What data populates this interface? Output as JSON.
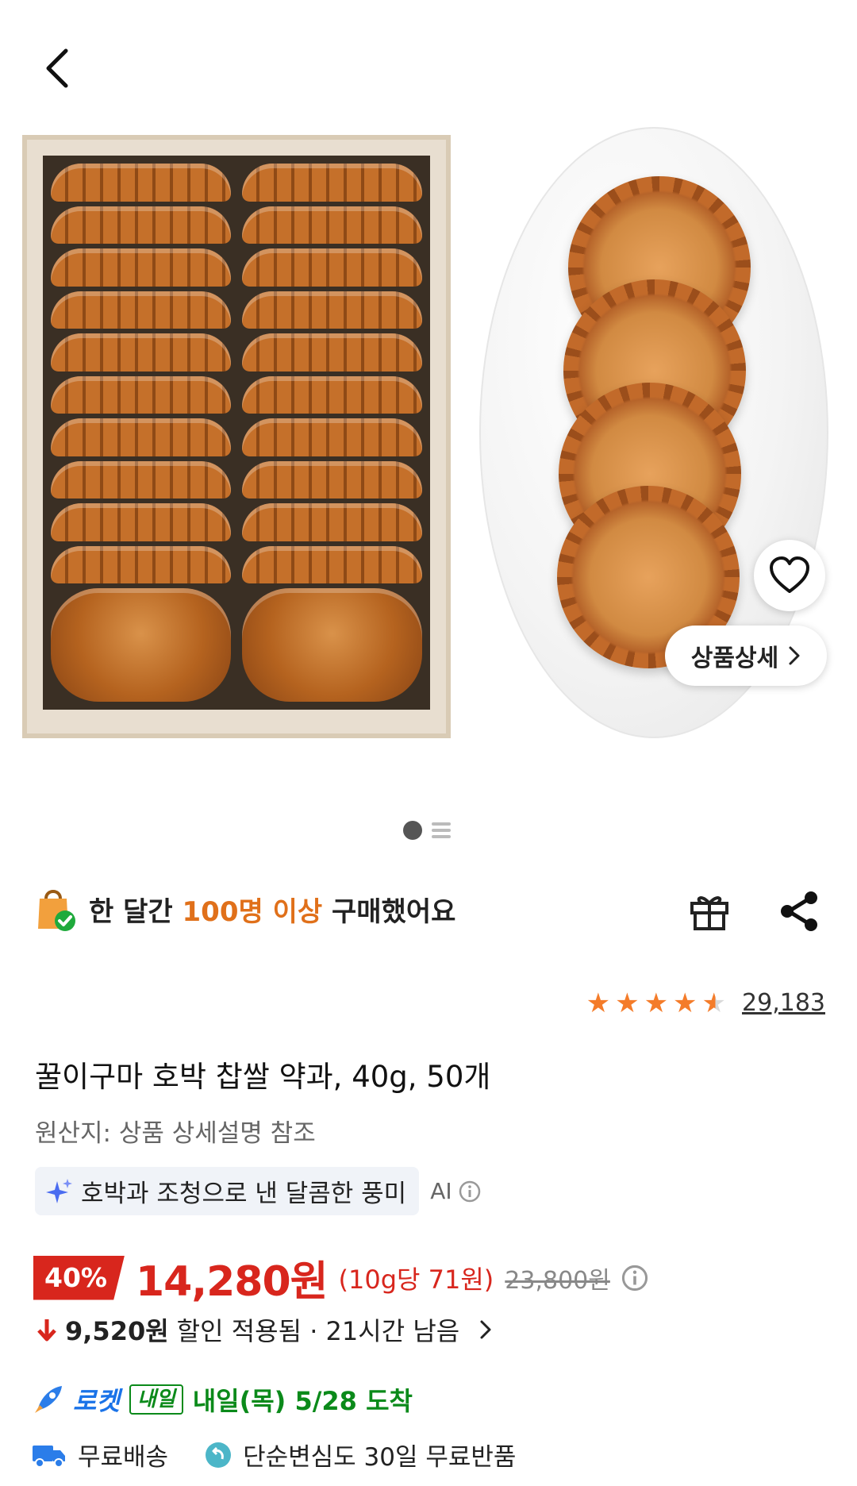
{
  "header": {
    "back_icon": "chevron-left-icon"
  },
  "gallery": {
    "detail_button_label": "상품상세",
    "page_indicator": {
      "current": 1,
      "total": 2
    }
  },
  "purchase_note": {
    "prefix": "한 달간 ",
    "highlight": "100명 이상",
    "suffix": " 구매했어요"
  },
  "rating": {
    "stars": 4.5,
    "review_count": "29,183"
  },
  "product": {
    "title": "꿀이구마 호박 찹쌀 약과, 40g, 50개",
    "origin": "원산지: 상품 상세설명 참조",
    "ai_summary": "호박과 조청으로 낸 달콤한 풍미",
    "ai_label": "AI"
  },
  "price": {
    "discount": "40%",
    "sale": "14,280원",
    "unit": "(10g당 71원)",
    "original": "23,800원"
  },
  "coupon": {
    "amount": "9,520원",
    "text": "할인 적용됨 · 21시간 남음"
  },
  "delivery": {
    "rocket_label": "로켓",
    "badge": "내일",
    "date_text": "내일(목) 5/28 도착",
    "free_shipping": "무료배송",
    "return_text": "단순변심도 30일 무료반품"
  },
  "colors": {
    "accent_red": "#d8261d",
    "orange": "#e0701a",
    "green": "#0b8a1a",
    "star": "#f47c2a"
  }
}
